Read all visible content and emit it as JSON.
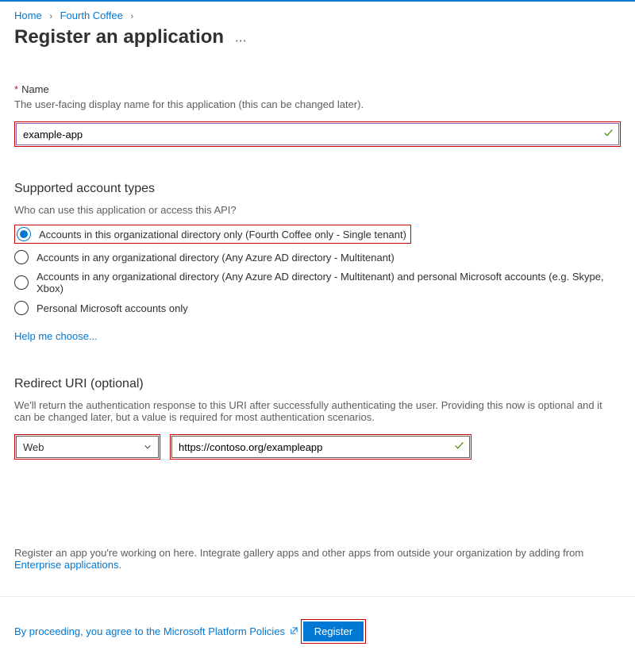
{
  "breadcrumb": {
    "home": "Home",
    "org": "Fourth Coffee"
  },
  "page_title": "Register an application",
  "name_field": {
    "label": "Name",
    "help": "The user-facing display name for this application (this can be changed later).",
    "value": "example-app"
  },
  "account_types": {
    "heading": "Supported account types",
    "question": "Who can use this application or access this API?",
    "options": [
      "Accounts in this organizational directory only (Fourth Coffee only - Single tenant)",
      "Accounts in any organizational directory (Any Azure AD directory - Multitenant)",
      "Accounts in any organizational directory (Any Azure AD directory - Multitenant) and personal Microsoft accounts (e.g. Skype, Xbox)",
      "Personal Microsoft accounts only"
    ],
    "help_link": "Help me choose..."
  },
  "redirect": {
    "heading": "Redirect URI (optional)",
    "help": "We'll return the authentication response to this URI after successfully authenticating the user. Providing this now is optional and it can be changed later, but a value is required for most authentication scenarios.",
    "platform": "Web",
    "uri": "https://contoso.org/exampleapp"
  },
  "bottom_note_prefix": "Register an app you're working on here. Integrate gallery apps and other apps from outside your organization by adding from ",
  "bottom_note_link": "Enterprise applications",
  "policy": "By proceeding, you agree to the Microsoft Platform Policies",
  "register_label": "Register"
}
